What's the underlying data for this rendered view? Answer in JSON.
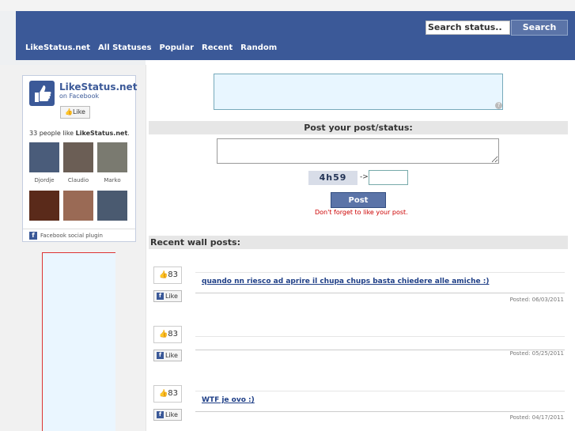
{
  "search": {
    "placeholder": "Search status..",
    "button_label": "Search"
  },
  "nav": [
    "LikeStatus.net",
    "All Statuses",
    "Popular",
    "Recent",
    "Random"
  ],
  "fb_widget": {
    "title": "LikeStatus.net",
    "subtitle": "on Facebook",
    "like_label": "Like",
    "people_text": "33 people like ",
    "people_brand": "LikeStatus.net",
    "people_suffix": ".",
    "faces": [
      {
        "name": "Djordje",
        "color": "#4a5c7a"
      },
      {
        "name": "Claudio",
        "color": "#6b5e55"
      },
      {
        "name": "Marko",
        "color": "#7a7a70"
      },
      {
        "name": "",
        "color": "#5a2a1a"
      },
      {
        "name": "",
        "color": "#9a6a55"
      },
      {
        "name": "",
        "color": "#4a5a70"
      }
    ],
    "footer": "Facebook social plugin"
  },
  "form": {
    "title": "Post your post/status:",
    "captcha_text": "4h59",
    "captcha_arrow": "->",
    "post_label": "Post",
    "warning": "Don't forget to like your post."
  },
  "wall": {
    "title": "Recent wall posts:",
    "like_label": "Like",
    "posts": [
      {
        "likes": "83",
        "text": "quando nn riesco ad aprire il chupa chups basta chiedere alle amiche :)",
        "date": "Posted: 06/03/2011"
      },
      {
        "likes": "83",
        "text": "",
        "date": "Posted: 05/25/2011"
      },
      {
        "likes": "83",
        "text": "WTF je ovo :)",
        "date": "Posted: 04/17/2011"
      }
    ]
  }
}
